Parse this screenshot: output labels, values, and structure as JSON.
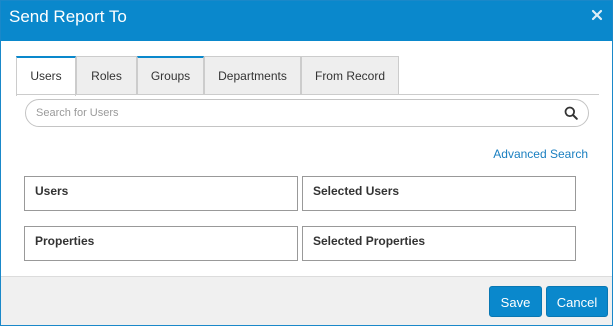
{
  "dialog": {
    "title": "Send Report To",
    "close_icon": "close-icon"
  },
  "tabs": [
    {
      "label": "Users",
      "active": true
    },
    {
      "label": "Roles",
      "active": false
    },
    {
      "label": "Groups",
      "active": false
    },
    {
      "label": "Departments",
      "active": false
    },
    {
      "label": "From Record",
      "active": false
    }
  ],
  "search": {
    "placeholder": "Search for Users",
    "value": "",
    "icon": "search-icon"
  },
  "advanced_search_label": "Advanced Search",
  "panels": {
    "users": "Users",
    "selected_users": "Selected Users",
    "properties": "Properties",
    "selected_properties": "Selected Properties"
  },
  "footer": {
    "save_label": "Save",
    "cancel_label": "Cancel"
  },
  "colors": {
    "accent": "#0a88cc",
    "link": "#1a7fc0"
  }
}
